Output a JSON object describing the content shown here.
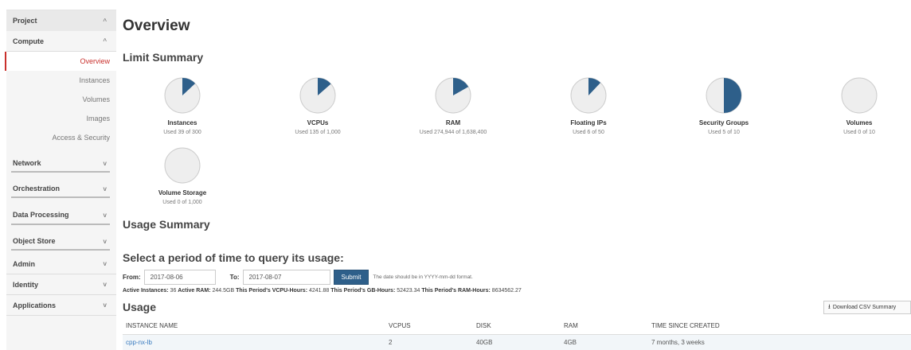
{
  "sidebar": {
    "project": "Project",
    "compute": "Compute",
    "items": [
      "Overview",
      "Instances",
      "Volumes",
      "Images",
      "Access & Security"
    ],
    "sections": [
      "Network",
      "Orchestration",
      "Data Processing",
      "Object Store"
    ],
    "bottom": [
      "Admin",
      "Identity",
      "Applications"
    ],
    "chev_up": "^",
    "chev_down": "v"
  },
  "page_title": "Overview",
  "limit_summary": "Limit Summary",
  "limits": [
    {
      "name": "Instances",
      "used_text": "Used 39 of 300",
      "fraction": 0.13
    },
    {
      "name": "VCPUs",
      "used_text": "Used 135 of 1,000",
      "fraction": 0.135
    },
    {
      "name": "RAM",
      "used_text": "Used 274,944 of 1,638,400",
      "fraction": 0.168
    },
    {
      "name": "Floating IPs",
      "used_text": "Used 6 of 50",
      "fraction": 0.12
    },
    {
      "name": "Security Groups",
      "used_text": "Used 5 of 10",
      "fraction": 0.5
    },
    {
      "name": "Volumes",
      "used_text": "Used 0 of 10",
      "fraction": 0
    },
    {
      "name": "Volume Storage",
      "used_text": "Used 0 of 1,000",
      "fraction": 0
    }
  ],
  "colors": {
    "pie_fill": "#2e5f8a",
    "pie_bg": "#eeeeee",
    "pie_border": "#cccccc"
  },
  "usage_summary": "Usage Summary",
  "query": {
    "heading": "Select a period of time to query its usage:",
    "from_label": "From:",
    "from_value": "2017-08-06",
    "to_label": "To:",
    "to_value": "2017-08-07",
    "submit": "Submit",
    "hint": "The date should be in YYYY-mm-dd format."
  },
  "stats": {
    "active_instances_label": "Active Instances:",
    "active_instances": "36",
    "active_ram_label": "Active RAM:",
    "active_ram": "244.5GB",
    "vcpu_hours_label": "This Period's VCPU-Hours:",
    "vcpu_hours": "4241.88",
    "gb_hours_label": "This Period's GB-Hours:",
    "gb_hours": "52423.34",
    "ram_hours_label": "This Period's RAM-Hours:",
    "ram_hours": "8634562.27"
  },
  "usage": {
    "title": "Usage",
    "download": "Download CSV Summary",
    "download_icon": "download-icon",
    "columns": [
      "INSTANCE NAME",
      "VCPUS",
      "DISK",
      "RAM",
      "TIME SINCE CREATED"
    ],
    "rows": [
      [
        "cpp-nx-lb",
        "2",
        "40GB",
        "4GB",
        "7 months, 3 weeks"
      ]
    ]
  }
}
